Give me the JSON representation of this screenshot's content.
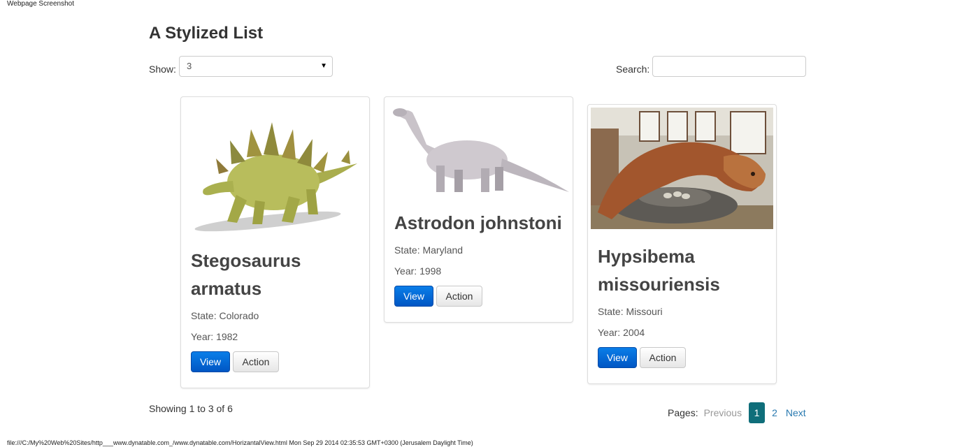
{
  "screenshot_header": "Webpage Screenshot",
  "page": {
    "title": "A Stylized List"
  },
  "controls": {
    "show_label": "Show:",
    "show_value": "3",
    "search_label": "Search:",
    "search_value": ""
  },
  "cards": [
    {
      "image_icon": "stegosaurus-image",
      "title_line1": "Stegosaurus",
      "title_line2": "armatus",
      "state": "State: Colorado",
      "year": "Year: 1982",
      "view_label": "View",
      "action_label": "Action"
    },
    {
      "image_icon": "astrodon-image",
      "title_line1": "Astrodon johnstoni",
      "title_line2": "",
      "state": "State: Maryland",
      "year": "Year: 1998",
      "view_label": "View",
      "action_label": "Action"
    },
    {
      "image_icon": "hypsibema-image",
      "title_line1": "Hypsibema",
      "title_line2": "missouriensis",
      "state": "State: Missouri",
      "year": "Year: 2004",
      "view_label": "View",
      "action_label": "Action"
    }
  ],
  "footer": {
    "showing": "Showing 1 to 3 of 6",
    "pages_label": "Pages:",
    "previous": "Previous",
    "pages": [
      "1",
      "2"
    ],
    "active_page": "1",
    "next": "Next"
  },
  "colors": {
    "primary_button": "#0056c4",
    "active_page": "#0f6e7a",
    "link": "#2a7ab0"
  },
  "screenshot_footer": "file:///C:/My%20Web%20Sites/http___www.dynatable.com_/www.dynatable.com/HorizantalView.html Mon Sep 29 2014 02:35:53 GMT+0300 (Jerusalem Daylight Time)"
}
